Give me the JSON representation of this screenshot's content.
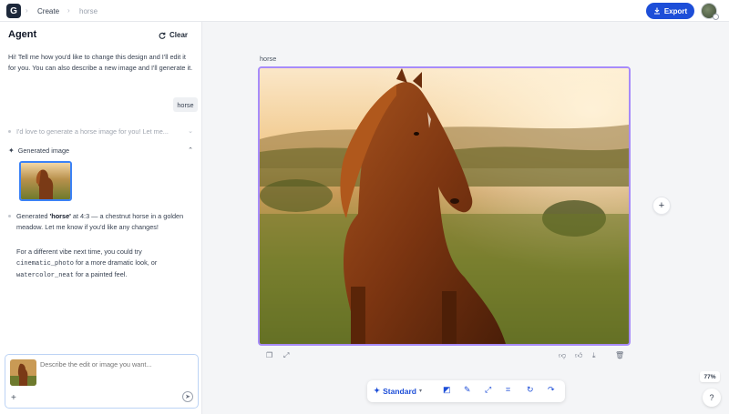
{
  "header": {
    "logo": "G",
    "breadcrumb": [
      "Create",
      "horse"
    ],
    "export_label": "Export"
  },
  "agent": {
    "title": "Agent",
    "clear_label": "Clear",
    "intro": "Hi! Tell me how you'd like to change this design and I'll edit it for you. You can also describe a new image and I'll generate it.",
    "user_message": "horse",
    "collapsed_reply": "I'd love to generate a horse image for you! Let me...",
    "generated_label": "Generated image",
    "result_prefix": "Generated ",
    "result_name": "'horse'",
    "result_suffix": " at 4:3 — a chestnut horse in a golden meadow. Let me know if you'd like any changes!",
    "tip_a": "For a different vibe next time, you could try ",
    "tip_code1": "cinematic_photo",
    "tip_b": " for a more dramatic look, or ",
    "tip_code2": "watercolor_neat",
    "tip_c": " for a painted feel."
  },
  "composer": {
    "placeholder": "Describe the edit or image you want..."
  },
  "canvas": {
    "label": "horse",
    "zoom": "77%"
  },
  "toolbar": {
    "mode_label": "Standard"
  },
  "icons": {
    "logo": "g-logo-icon",
    "export": "download-icon",
    "clear": "refresh-icon",
    "spark": "sparkle-icon",
    "help": "question-icon"
  },
  "colors": {
    "accent": "#1d4ed8",
    "selection": "#a78bfa"
  }
}
